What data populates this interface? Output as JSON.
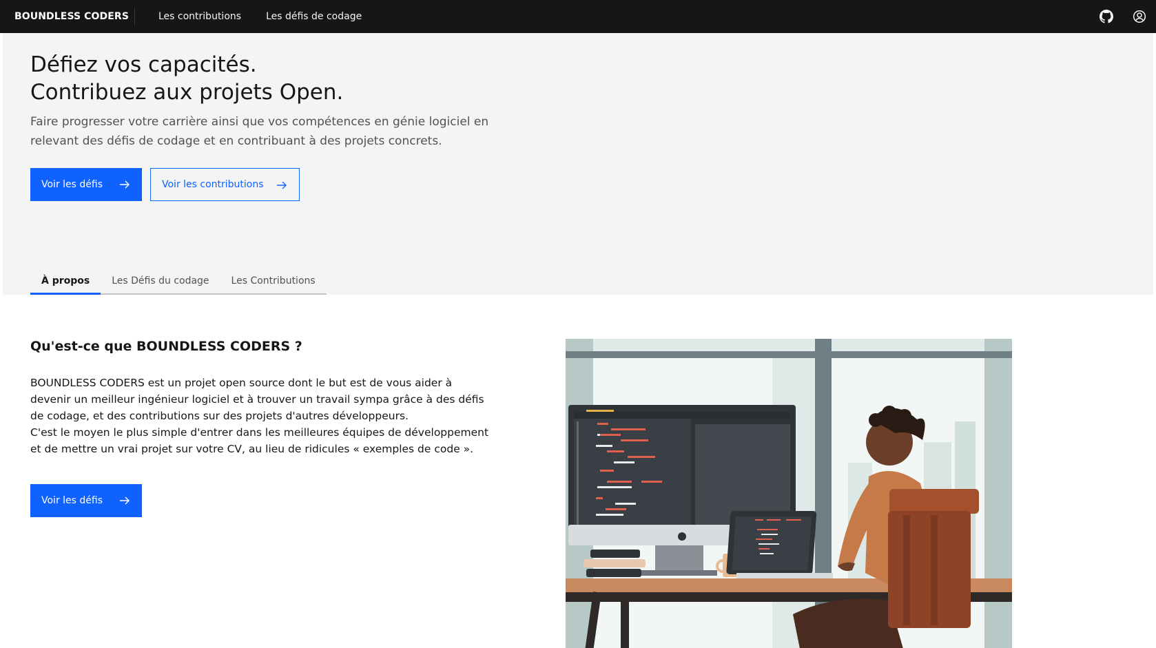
{
  "header": {
    "brand": "BOUNDLESS CODERS",
    "nav": [
      "Les contributions",
      "Les défis de codage"
    ],
    "icons": [
      "github-icon",
      "user-avatar-icon"
    ]
  },
  "hero": {
    "title_line1": "Défiez vos capacités.",
    "title_line2": "Contribuez aux projets Open.",
    "subtitle": "Faire progresser votre carrière ainsi que vos compétences en génie logiciel en relevant des défis de codage et en contribuant à des projets concrets.",
    "primary_button": "Voir les défis",
    "secondary_button": "Voir les contributions"
  },
  "tabs": [
    "À propos",
    "Les Défis du codage",
    "Les Contributions"
  ],
  "about": {
    "title": "Qu'est-ce que BOUNDLESS CODERS ?",
    "brand_inline": "BOUNDLESS CODERS",
    "paragraph1_rest": " est un projet open source dont le but est de vous aider à devenir un meilleur ingénieur logiciel et à trouver un travail sympa grâce à des défis de codage, et des contributions sur des projets d'autres développeurs.",
    "paragraph2": "C'est le moyen le plus simple d'entrer dans les meilleures équipes de développement et de mettre un vrai projet sur votre CV, au lieu de ridicules « exemples de code ».",
    "button": "Voir les défis"
  },
  "colors": {
    "header_bg": "#161616",
    "hero_bg": "#f4f4f4",
    "primary": "#0f62fe"
  }
}
